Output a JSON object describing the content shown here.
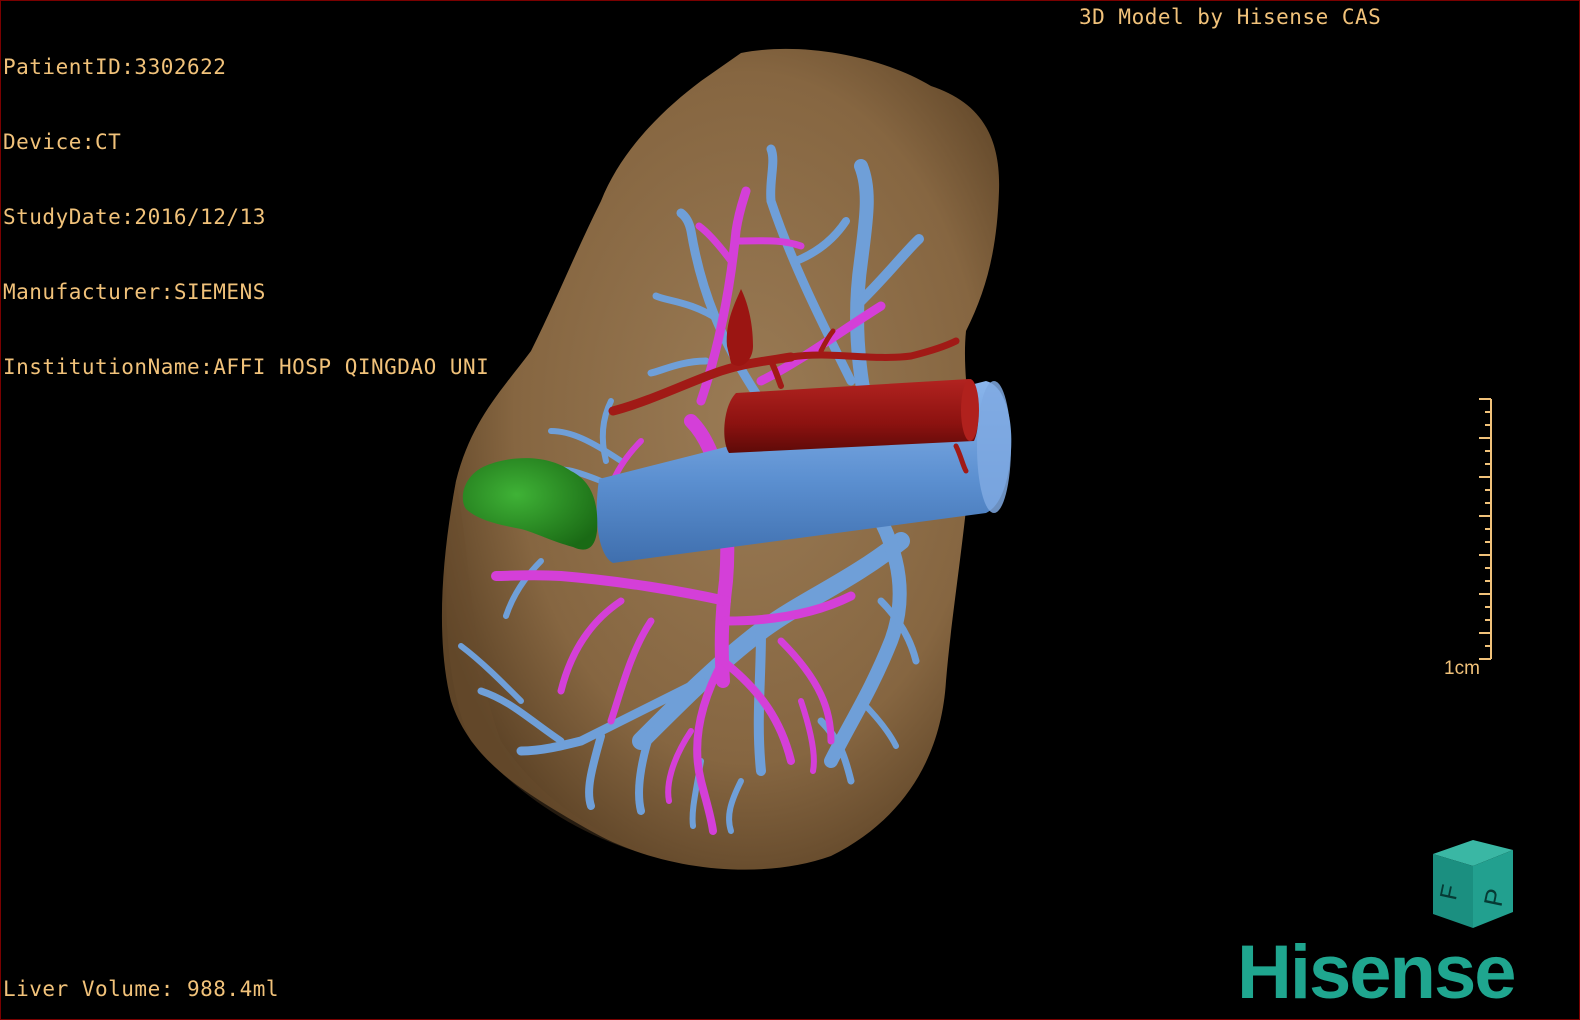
{
  "study_info": {
    "patient_id": "PatientID:3302622",
    "device": "Device:CT",
    "study_date": "StudyDate:2016/12/13",
    "manufacturer": "Manufacturer:SIEMENS",
    "institution": "InstitutionName:AFFI HOSP QINGDAO UNI"
  },
  "header": {
    "brand_label": "3D Model by Hisense CAS"
  },
  "footer": {
    "liver_volume": "Liver Volume: 988.4ml"
  },
  "scale": {
    "label": "1cm"
  },
  "orientation_cube": {
    "face_left": "F",
    "face_right": "P"
  },
  "logo": {
    "text": "Hisense"
  },
  "colors": {
    "overlay_text": "#f1c27a",
    "liver": "#8b6b47",
    "hepatic_vein": "#6f9fd8",
    "portal_vein": "#d43fd8",
    "artery": "#9b1512",
    "tumor": "#2a8f23",
    "logo": "#1fa68f"
  }
}
